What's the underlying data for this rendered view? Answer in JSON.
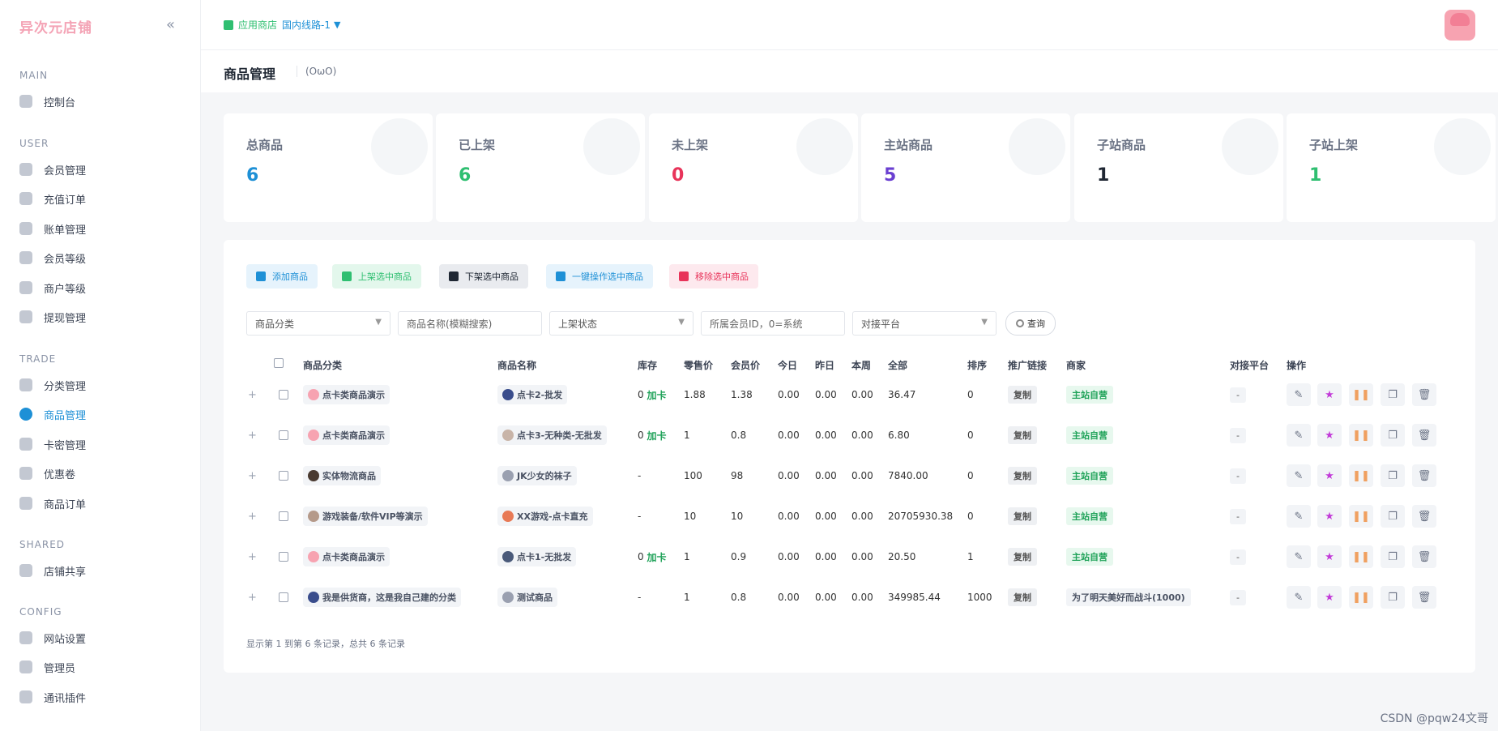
{
  "brand": "异次元店铺",
  "sidebar": {
    "sections": [
      {
        "title": "MAIN",
        "items": [
          {
            "label": "控制台"
          }
        ]
      },
      {
        "title": "USER",
        "items": [
          {
            "label": "会员管理"
          },
          {
            "label": "充值订单"
          },
          {
            "label": "账单管理"
          },
          {
            "label": "会员等级"
          },
          {
            "label": "商户等级"
          },
          {
            "label": "提现管理"
          }
        ]
      },
      {
        "title": "TRADE",
        "items": [
          {
            "label": "分类管理"
          },
          {
            "label": "商品管理"
          },
          {
            "label": "卡密管理"
          },
          {
            "label": "优惠卷"
          },
          {
            "label": "商品订单"
          }
        ]
      },
      {
        "title": "SHARED",
        "items": [
          {
            "label": "店铺共享"
          }
        ]
      },
      {
        "title": "CONFIG",
        "items": [
          {
            "label": "网站设置"
          },
          {
            "label": "管理员"
          },
          {
            "label": "通讯插件"
          }
        ]
      }
    ],
    "active": "商品管理"
  },
  "topbar": {
    "store_label": "应用商店",
    "route": "国内线路-1"
  },
  "page": {
    "title": "商品管理",
    "subtitle": "(OωO)"
  },
  "stats": [
    {
      "label": "总商品",
      "value": "6",
      "color": "#1e90d6"
    },
    {
      "label": "已上架",
      "value": "6",
      "color": "#2fbf71"
    },
    {
      "label": "未上架",
      "value": "0",
      "color": "#e8345a"
    },
    {
      "label": "主站商品",
      "value": "5",
      "color": "#6a3fd1"
    },
    {
      "label": "子站商品",
      "value": "1",
      "color": "#1f2733"
    },
    {
      "label": "子站上架",
      "value": "1",
      "color": "#2fbf71"
    }
  ],
  "buttons": {
    "add": "添加商品",
    "list_selected": "上架选中商品",
    "unlist_selected": "下架选中商品",
    "bulk": "一键操作选中商品",
    "remove": "移除选中商品"
  },
  "filters": {
    "category": "商品分类",
    "name": "商品名称(模糊搜索)",
    "status": "上架状态",
    "member_id": "所属会员ID，0=系统",
    "platform": "对接平台",
    "query": "查询"
  },
  "table": {
    "headers": [
      "商品分类",
      "商品名称",
      "库存",
      "零售价",
      "会员价",
      "今日",
      "昨日",
      "本周",
      "全部",
      "排序",
      "推广链接",
      "商家",
      "对接平台",
      "操作"
    ],
    "rows": [
      {
        "category": "点卡类商品演示",
        "name": "点卡2-批发",
        "stock": "0",
        "stock_link": "加卡",
        "retail": "1.88",
        "member": "1.38",
        "today": "0.00",
        "yesterday": "0.00",
        "week": "0.00",
        "all": "36.47",
        "sort": "0",
        "promo": "复制",
        "merchant": "主站自营",
        "platform": "-"
      },
      {
        "category": "点卡类商品演示",
        "name": "点卡3-无种类-无批发",
        "stock": "0",
        "stock_link": "加卡",
        "retail": "1",
        "member": "0.8",
        "today": "0.00",
        "yesterday": "0.00",
        "week": "0.00",
        "all": "6.80",
        "sort": "0",
        "promo": "复制",
        "merchant": "主站自营",
        "platform": "-"
      },
      {
        "category": "实体物流商品",
        "name": "JK少女的袜子",
        "stock": "-",
        "stock_link": "",
        "retail": "100",
        "member": "98",
        "today": "0.00",
        "yesterday": "0.00",
        "week": "0.00",
        "all": "7840.00",
        "sort": "0",
        "promo": "复制",
        "merchant": "主站自营",
        "platform": "-"
      },
      {
        "category": "游戏装备/软件VIP等演示",
        "name": "XX游戏-点卡直充",
        "stock": "-",
        "stock_link": "",
        "retail": "10",
        "member": "10",
        "today": "0.00",
        "yesterday": "0.00",
        "week": "0.00",
        "all": "20705930.38",
        "sort": "0",
        "promo": "复制",
        "merchant": "主站自营",
        "platform": "-"
      },
      {
        "category": "点卡类商品演示",
        "name": "点卡1-无批发",
        "stock": "0",
        "stock_link": "加卡",
        "retail": "1",
        "member": "0.9",
        "today": "0.00",
        "yesterday": "0.00",
        "week": "0.00",
        "all": "20.50",
        "sort": "1",
        "promo": "复制",
        "merchant": "主站自营",
        "platform": "-"
      },
      {
        "category": "我是供货商，这是我自己建的分类",
        "name": "测试商品",
        "stock": "-",
        "stock_link": "",
        "retail": "1",
        "member": "0.8",
        "today": "0.00",
        "yesterday": "0.00",
        "week": "0.00",
        "all": "349985.44",
        "sort": "1000",
        "promo": "复制",
        "merchant": "为了明天美好而战斗(1000)",
        "platform": "-"
      }
    ],
    "footer": "显示第 1 到第 6 条记录，总共 6 条记录"
  },
  "watermark": "CSDN @pqw24文哥"
}
